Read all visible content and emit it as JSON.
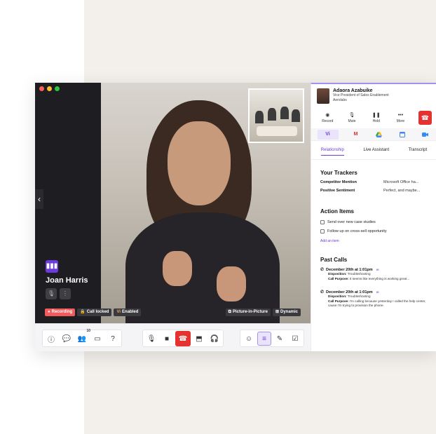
{
  "caller": {
    "name": "Joan Harris",
    "badge_icon": "soundwave-icon"
  },
  "video_status": {
    "recording": "Recording",
    "call_locked": "Call locked",
    "vi_prefix": "Vi",
    "vi_enabled": "Enabled"
  },
  "video_tools": {
    "pip": "Picture-in-Picture",
    "dynamic": "Dynamic"
  },
  "toolbar": {
    "participants_count": "10"
  },
  "contact": {
    "name": "Adaora Azabuike",
    "title": "Vice President of Sales Enablement",
    "company": "Aerolabs"
  },
  "call_actions": {
    "record": "Record",
    "mute": "Mute",
    "hold": "Hold",
    "more": "More"
  },
  "apps": {
    "vi": "Vi"
  },
  "tabs": {
    "relationship": "Relationship",
    "live_assistant": "Live Assistant",
    "transcript": "Transcript"
  },
  "trackers": {
    "title": "Your Trackers",
    "rows": [
      {
        "name": "Competitor Mention",
        "value": "Microsoft Office ha..."
      },
      {
        "name": "Positive Sentiment",
        "value": "Perfect, and maybe..."
      }
    ]
  },
  "action_items": {
    "title": "Action Items",
    "items": [
      "Send over new case studies",
      "Follow up on cross-sell opportunity"
    ],
    "add": "Add an item"
  },
  "past_calls": {
    "title": "Past Calls",
    "disposition_label": "Disposition:",
    "purpose_label": "Call Purpose:",
    "calls": [
      {
        "date": "December 20th at 1:01pm",
        "tag": "VI",
        "disposition": "Troubleshooting",
        "purpose": "It seems like everything is working great..."
      },
      {
        "date": "December 20th at 1:01pm",
        "tag": "VI",
        "disposition": "Troubleshooting",
        "purpose": "I'm calling because yesterday I called the help center, cause I'm trying to provision the phone."
      }
    ]
  },
  "colors": {
    "accent": "#6b3cdb",
    "end_call": "#e5312f",
    "recording": "#f15b5b",
    "background_panel": "#f3efea"
  }
}
